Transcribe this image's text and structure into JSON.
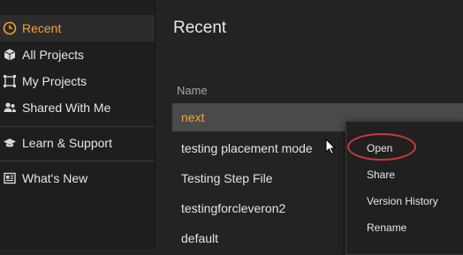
{
  "sidebar": {
    "items": [
      {
        "label": "Recent",
        "icon": "clock-icon",
        "active": true
      },
      {
        "label": "All Projects",
        "icon": "cube-icon"
      },
      {
        "label": "My Projects",
        "icon": "frame-icon"
      },
      {
        "label": "Shared With Me",
        "icon": "shared-users-icon"
      },
      {
        "label": "Learn & Support",
        "icon": "graduation-cap-icon"
      },
      {
        "label": "What's New",
        "icon": "news-icon"
      }
    ]
  },
  "main": {
    "title": "Recent",
    "column_header": "Name",
    "rows": [
      {
        "name": "next",
        "selected": true
      },
      {
        "name": "testing placement mode"
      },
      {
        "name": "Testing Step File"
      },
      {
        "name": "testingforcleveron2"
      },
      {
        "name": "default"
      }
    ]
  },
  "context_menu": {
    "items": [
      "Open",
      "Share",
      "Version History",
      "Rename"
    ],
    "highlighted": "Open"
  },
  "colors": {
    "accent": "#f0a23a",
    "sidebar_bg": "#1e1e1e",
    "main_bg": "#232323",
    "selected_row_bg": "#4a4a4a",
    "highlight_ring": "#c83a3a"
  }
}
